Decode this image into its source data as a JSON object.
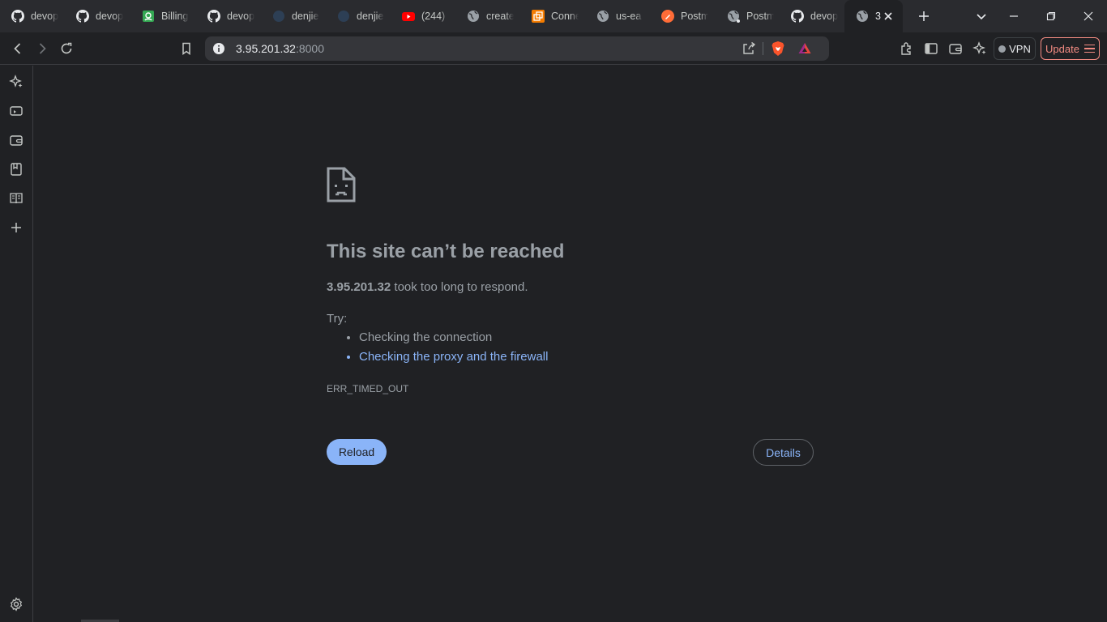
{
  "tabs": [
    {
      "label": "devop",
      "icon": "github-icon"
    },
    {
      "label": "devop",
      "icon": "github-icon"
    },
    {
      "label": "Billing",
      "icon": "billing-icon",
      "color": "#34a853"
    },
    {
      "label": "devop",
      "icon": "github-icon"
    },
    {
      "label": "denjie",
      "icon": "denjie-icon"
    },
    {
      "label": "denjie",
      "icon": "denjie-icon"
    },
    {
      "label": "(244)",
      "icon": "youtube-icon",
      "color": "#ff0000"
    },
    {
      "label": "create",
      "icon": "globe-icon"
    },
    {
      "label": "Conne",
      "icon": "connect-icon",
      "color": "#f57c00"
    },
    {
      "label": "us-ea",
      "icon": "globe-icon"
    },
    {
      "label": "Postm",
      "icon": "postman-icon",
      "color": "#ff6c37"
    },
    {
      "label": "Postm",
      "icon": "globe-icon"
    },
    {
      "label": "devop",
      "icon": "github-icon"
    },
    {
      "label": "3",
      "icon": "globe-icon",
      "active": true
    }
  ],
  "address_bar": {
    "host": "3.95.201.32",
    "port": ":8000"
  },
  "toolbar": {
    "vpn_label": "VPN",
    "update_label": "Update"
  },
  "error_page": {
    "title": "This site can’t be reached",
    "host": "3.95.201.32",
    "message": " took too long to respond.",
    "try_label": "Try:",
    "suggestions": [
      "Checking the connection",
      "Checking the proxy and the firewall"
    ],
    "error_code": "ERR_TIMED_OUT",
    "reload_label": "Reload",
    "details_label": "Details"
  },
  "colors": {
    "accent": "#8ab4f8",
    "update": "#f28b82",
    "background": "#202124"
  }
}
